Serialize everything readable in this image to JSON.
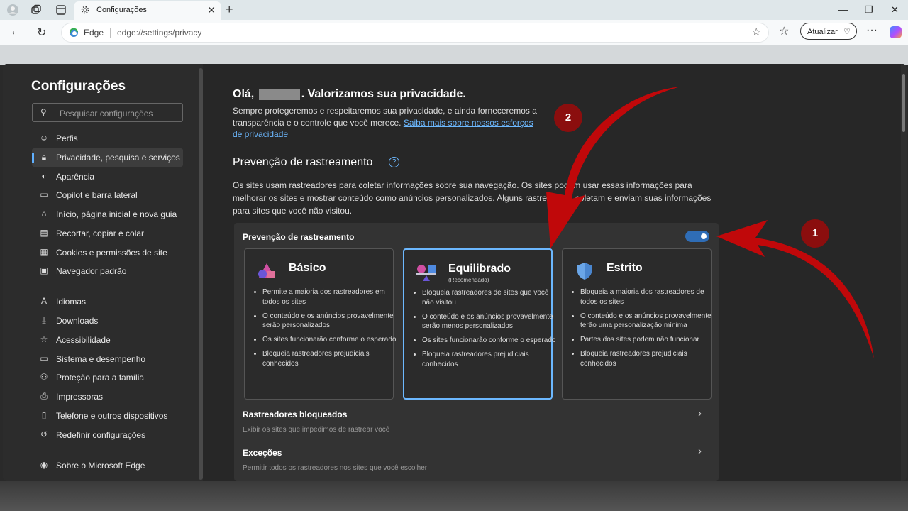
{
  "browser": {
    "tab_title": "Configurações",
    "close_tab_glyph": "✕",
    "new_tab_glyph": "+",
    "brand": "Edge",
    "url": "edge://settings/privacy",
    "update_label": "Atualizar"
  },
  "sidebar": {
    "title": "Configurações",
    "search_placeholder": "Pesquisar configurações",
    "items": [
      {
        "label": "Perfis",
        "icon": "profile-icon"
      },
      {
        "label": "Privacidade, pesquisa e serviços",
        "icon": "lock-icon",
        "active": true
      },
      {
        "label": "Aparência",
        "icon": "palette-icon"
      },
      {
        "label": "Copilot e barra lateral",
        "icon": "sidebar-icon"
      },
      {
        "label": "Início, página inicial e nova guia",
        "icon": "home-icon"
      },
      {
        "label": "Recortar, copiar e colar",
        "icon": "clipboard-icon"
      },
      {
        "label": "Cookies e permissões de site",
        "icon": "cookie-icon"
      },
      {
        "label": "Navegador padrão",
        "icon": "browser-icon"
      },
      {
        "label": "Idiomas",
        "icon": "language-icon"
      },
      {
        "label": "Downloads",
        "icon": "download-icon"
      },
      {
        "label": "Acessibilidade",
        "icon": "accessibility-icon"
      },
      {
        "label": "Sistema e desempenho",
        "icon": "system-icon"
      },
      {
        "label": "Proteção para a família",
        "icon": "family-icon"
      },
      {
        "label": "Impressoras",
        "icon": "printer-icon"
      },
      {
        "label": "Telefone e outros dispositivos",
        "icon": "phone-icon"
      },
      {
        "label": "Redefinir configurações",
        "icon": "reset-icon"
      },
      {
        "label": "Sobre o Microsoft Edge",
        "icon": "edge-icon"
      }
    ]
  },
  "main": {
    "greeting_before": "Olá,",
    "greeting_after": ". Valorizamos sua privacidade.",
    "intro_text": "Sempre protegeremos e respeitaremos sua privacidade, e ainda forneceremos a transparência e o controle que você merece.",
    "intro_link": "Saiba mais sobre nossos esforços de privacidade",
    "tp_heading": "Prevenção de rastreamento",
    "tp_help": "?",
    "tp_desc": "Os sites usam rastreadores para coletar informações sobre sua navegação. Os sites podem usar essas informações para melhorar os sites e mostrar conteúdo como anúncios personalizados. Alguns rastreadores coletam e enviam suas informações para sites que você não visitou.",
    "tp_card_label": "Prevenção de rastreamento",
    "tp_enabled": true,
    "levels": [
      {
        "title": "Básico",
        "subtitle": "",
        "bullets": [
          "Permite a maioria dos rastreadores em todos os sites",
          "O conteúdo e os anúncios provavelmente serão personalizados",
          "Os sites funcionarão conforme o esperado",
          "Bloqueia rastreadores prejudiciais conhecidos"
        ]
      },
      {
        "title": "Equilibrado",
        "subtitle": "(Recomendado)",
        "bullets": [
          "Bloqueia rastreadores de sites que você não visitou",
          "O conteúdo e os anúncios provavelmente serão menos personalizados",
          "Os sites funcionarão conforme o esperado",
          "Bloqueia rastreadores prejudiciais conhecidos"
        ]
      },
      {
        "title": "Estrito",
        "subtitle": "",
        "bullets": [
          "Bloqueia a maioria dos rastreadores de todos os sites",
          "O conteúdo e os anúncios provavelmente terão uma personalização mínima",
          "Partes dos sites podem não funcionar",
          "Bloqueia rastreadores prejudiciais conhecidos"
        ]
      }
    ],
    "selected_level": "Equilibrado",
    "rows": [
      {
        "title": "Rastreadores bloqueados",
        "desc": "Exibir os sites que impedimos de rastrear você"
      },
      {
        "title": "Exceções",
        "desc": "Permitir todos os rastreadores nos sites que você escolher"
      }
    ]
  },
  "annotations": {
    "badge_1": "1",
    "badge_2": "2",
    "arrow_color": "#c0080a"
  }
}
